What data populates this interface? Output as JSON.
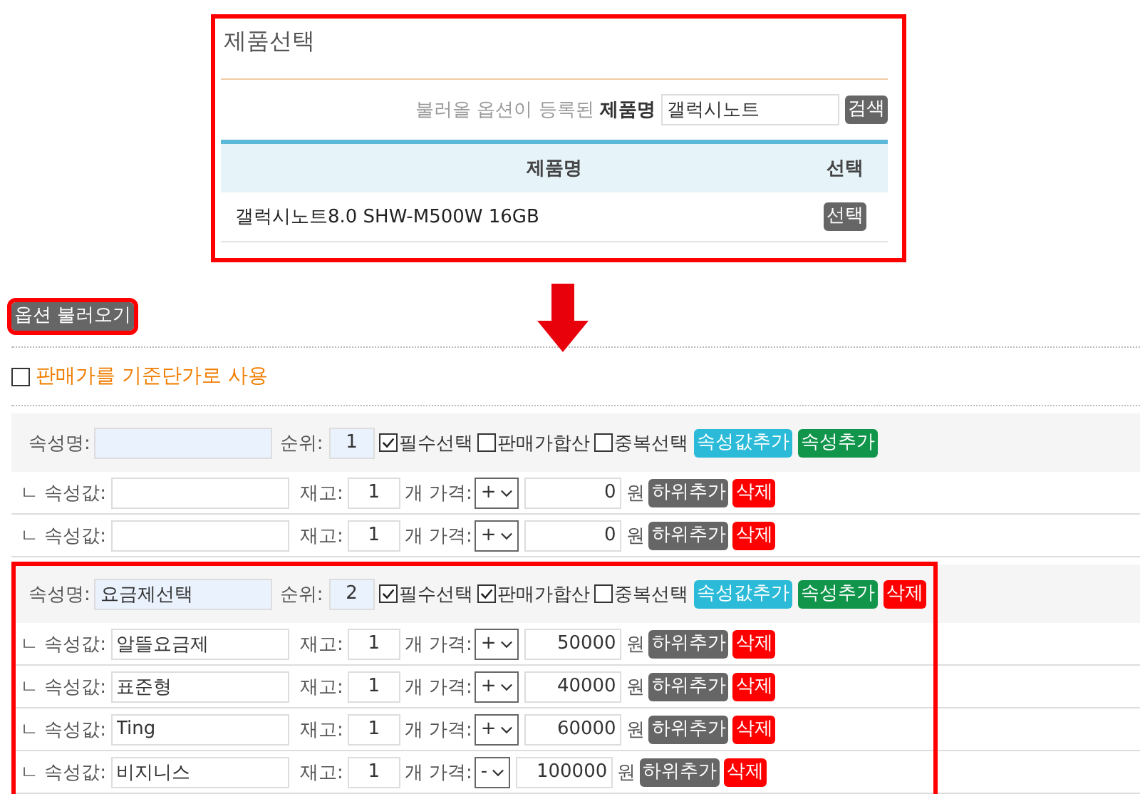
{
  "product_panel": {
    "highlighted": true,
    "title": "제품선택",
    "search_label": "불러올 옵션이 등록된 **제품명**",
    "search_value": "갤럭시노트",
    "search_button": "검색",
    "table": {
      "columns": [
        "제품명",
        "선택"
      ],
      "rows": [
        {
          "name": "갤럭시노트8.0 SHW-M500W 16GB",
          "button": "선택"
        }
      ]
    }
  },
  "arrow": {
    "kind": "down"
  },
  "load_button": {
    "label": "옵션 불러오기",
    "highlighted": true
  },
  "base_price_option": {
    "label": "판매가를 기준단가로 사용",
    "checked": false
  },
  "groups": [
    {
      "highlighted": false,
      "name_label": "속성명:",
      "order_label": "순위:",
      "order": "1",
      "checks": [
        {
          "label": "필수선택",
          "checked": true
        },
        {
          "label": "판매가합산",
          "checked": false
        },
        {
          "label": "중복선택",
          "checked": false
        }
      ],
      "buttons": [
        {
          "label": "속성값추가",
          "kind": "info"
        },
        {
          "label": "속성추가",
          "kind": "success"
        }
      ],
      "values": [
        {
          "label": "ㄴ 속성값:",
          "stock_label": "재고:",
          "stock": "1",
          "price_label": "개 가격:",
          "sign": "+",
          "price": "0",
          "currency": "원",
          "buttons": [
            {
              "label": "하위추가",
              "kind": "dark"
            },
            {
              "label": "삭제",
              "kind": "danger"
            }
          ]
        },
        {
          "label": "ㄴ 속성값:",
          "stock_label": "재고:",
          "stock": "1",
          "price_label": "개 가격:",
          "sign": "+",
          "price": "0",
          "currency": "원",
          "buttons": [
            {
              "label": "하위추가",
              "kind": "dark"
            },
            {
              "label": "삭제",
              "kind": "danger"
            }
          ]
        }
      ]
    },
    {
      "highlighted": true,
      "name_label": "속성명:",
      "name": "요금제선택",
      "order_label": "순위:",
      "order": "2",
      "checks": [
        {
          "label": "필수선택",
          "checked": true
        },
        {
          "label": "판매가합산",
          "checked": true
        },
        {
          "label": "중복선택",
          "checked": false
        }
      ],
      "buttons": [
        {
          "label": "속성값추가",
          "kind": "info"
        },
        {
          "label": "속성추가",
          "kind": "success"
        },
        {
          "label": "삭제",
          "kind": "danger"
        }
      ],
      "values": [
        {
          "label": "ㄴ 속성값:",
          "value": "알뜰요금제",
          "stock_label": "재고:",
          "stock": "1",
          "price_label": "개 가격:",
          "sign": "+",
          "price": "50000",
          "currency": "원",
          "buttons": [
            {
              "label": "하위추가",
              "kind": "dark"
            },
            {
              "label": "삭제",
              "kind": "danger"
            }
          ]
        },
        {
          "label": "ㄴ 속성값:",
          "value": "표준형",
          "stock_label": "재고:",
          "stock": "1",
          "price_label": "개 가격:",
          "sign": "+",
          "price": "40000",
          "currency": "원",
          "buttons": [
            {
              "label": "하위추가",
              "kind": "dark"
            },
            {
              "label": "삭제",
              "kind": "danger"
            }
          ]
        },
        {
          "label": "ㄴ 속성값:",
          "value": "Ting",
          "stock_label": "재고:",
          "stock": "1",
          "price_label": "개 가격:",
          "sign": "+",
          "price": "60000",
          "currency": "원",
          "buttons": [
            {
              "label": "하위추가",
              "kind": "dark"
            },
            {
              "label": "삭제",
              "kind": "danger"
            }
          ]
        },
        {
          "label": "ㄴ 속성값:",
          "value": "비지니스",
          "stock_label": "재고:",
          "stock": "1",
          "price_label": "개 가격:",
          "sign": "-",
          "price": "100000",
          "currency": "원",
          "buttons": [
            {
              "label": "하위추가",
              "kind": "dark"
            },
            {
              "label": "삭제",
              "kind": "danger"
            }
          ]
        }
      ]
    }
  ]
}
